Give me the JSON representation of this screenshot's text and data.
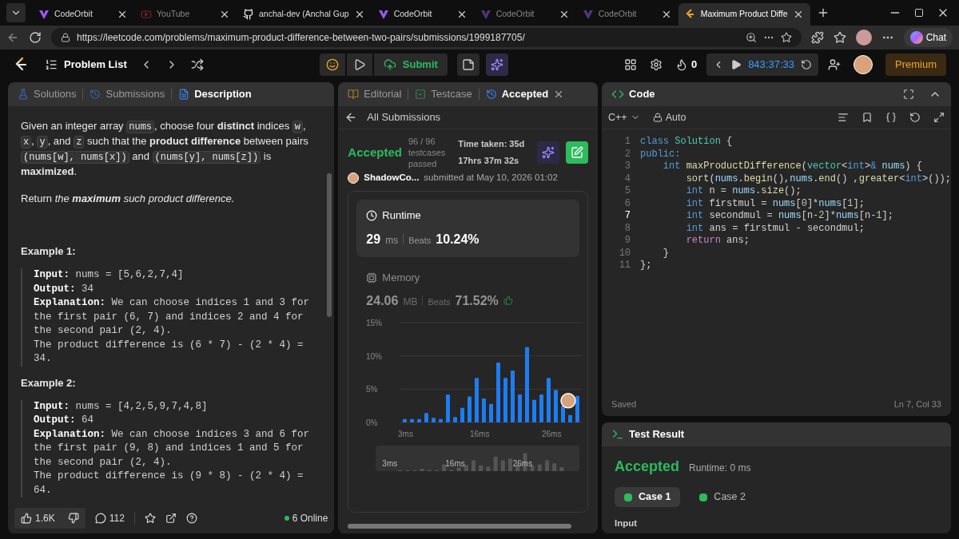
{
  "browser": {
    "tabs": [
      {
        "title": "CodeOrbit",
        "selected": false,
        "sleeping": false
      },
      {
        "title": "YouTube",
        "selected": false,
        "sleeping": true
      },
      {
        "title": "anchal-dev (Anchal Gup",
        "selected": false,
        "sleeping": false
      },
      {
        "title": "CodeOrbit",
        "selected": false,
        "sleeping": false
      },
      {
        "title": "CodeOrbit",
        "selected": false,
        "sleeping": true
      },
      {
        "title": "CodeOrbit",
        "selected": false,
        "sleeping": true
      },
      {
        "title": "Maximum Product Diffe",
        "selected": true,
        "sleeping": false
      }
    ],
    "url": "https://leetcode.com/problems/maximum-product-difference-between-two-pairs/submissions/1999187705/",
    "chat": "Chat"
  },
  "nav": {
    "problem_list": "Problem List",
    "submit": "Submit",
    "streak": "0",
    "timer": "843:37:33",
    "premium": "Premium"
  },
  "description_panel": {
    "tabs": [
      {
        "label": "Solutions",
        "selected": false
      },
      {
        "label": "Submissions",
        "selected": false
      },
      {
        "label": "Description",
        "selected": true
      }
    ],
    "paragraphs": [
      [
        {
          "kind": "text",
          "text": "Given an integer array "
        },
        {
          "kind": "code",
          "text": "nums"
        },
        {
          "kind": "text",
          "text": ", choose four **distinct** indices "
        },
        {
          "kind": "code",
          "text": "w"
        },
        {
          "kind": "text",
          "text": ", "
        },
        {
          "kind": "code",
          "text": "x"
        },
        {
          "kind": "text",
          "text": ", "
        },
        {
          "kind": "code",
          "text": "y"
        },
        {
          "kind": "text",
          "text": ", and "
        },
        {
          "kind": "code",
          "text": "z"
        },
        {
          "kind": "text",
          "text": " such that the **product difference** between pairs "
        },
        {
          "kind": "code",
          "text": "(nums[w], nums[x])"
        },
        {
          "kind": "text",
          "text": " and "
        },
        {
          "kind": "code",
          "text": "(nums[y], nums[z])"
        },
        {
          "kind": "text",
          "text": " is **maximized**."
        }
      ],
      [
        {
          "kind": "text",
          "text": "Return "
        },
        {
          "kind": "em",
          "text": "the **maximum** such product difference."
        }
      ]
    ],
    "examples": [
      {
        "title": "Example 1:",
        "lines": [
          {
            "label": "Input:",
            "text": "nums = [5,6,2,7,4]"
          },
          {
            "label": "Output:",
            "text": "34"
          },
          {
            "label": "Explanation:",
            "text": "We can choose indices 1 and 3 for the first pair (6, 7) and indices 2 and 4 for the second pair (2, 4)."
          },
          {
            "text": "The product difference is (6 * 7) - (2 * 4) = 34."
          }
        ]
      },
      {
        "title": "Example 2:",
        "lines": [
          {
            "label": "Input:",
            "text": "nums = [4,2,5,9,7,4,8]"
          },
          {
            "label": "Output:",
            "text": "64"
          },
          {
            "label": "Explanation:",
            "text": "We can choose indices 3 and 6 for the first pair (9, 8) and indices 1 and 5 for the second pair (2, 4)."
          },
          {
            "text": "The product difference is (9 * 8) - (2 * 4) = 64."
          }
        ]
      }
    ],
    "likes": "1.6K",
    "comments": "112",
    "online": "6 Online"
  },
  "submission_panel": {
    "tabs": [
      {
        "label": "Editorial",
        "selected": false,
        "closable": false
      },
      {
        "label": "Testcase",
        "selected": false,
        "closable": false
      },
      {
        "label": "Accepted",
        "selected": true,
        "closable": true
      }
    ],
    "back": "All Submissions",
    "status": "Accepted",
    "tests": [
      "96 / 96",
      "testcases",
      "passed"
    ],
    "time_taken": [
      "Time taken: 35d",
      "17hrs 37m 32s"
    ],
    "user": "ShadowCo...",
    "submitted": "submitted at May 10, 2026 01:02",
    "runtime": {
      "title": "Runtime",
      "value": "29",
      "unit": "ms",
      "beats_label": "Beats",
      "beats": "10.24%"
    },
    "memory": {
      "title": "Memory",
      "value": "24.06",
      "unit": "MB",
      "beats_label": "Beats",
      "beats": "71.52%"
    },
    "chart_data": {
      "type": "bar",
      "categories": [
        "3ms",
        null,
        null,
        null,
        null,
        null,
        null,
        null,
        null,
        null,
        "16ms",
        null,
        null,
        null,
        null,
        null,
        null,
        null,
        null,
        null,
        "26ms",
        null,
        null,
        null,
        null
      ],
      "values": [
        0.5,
        0.5,
        0.5,
        1.4,
        0.7,
        0.5,
        4.2,
        0.8,
        2.2,
        3.9,
        6.7,
        3.6,
        2.8,
        9.0,
        6.7,
        7.8,
        4.2,
        11.3,
        3.4,
        4.2,
        6.7,
        4.9,
        2.5,
        1.1,
        4.0
      ],
      "ylim": [
        0,
        15
      ],
      "yticks": [
        {
          "value": 0,
          "label": "0%"
        },
        {
          "value": 5,
          "label": "5%"
        },
        {
          "value": 10,
          "label": "10%"
        },
        {
          "value": 15,
          "label": "15%"
        }
      ]
    },
    "overview_labels": [
      "3ms",
      "16ms",
      "26ms"
    ]
  },
  "code_panel": {
    "title": "Code",
    "language": "C++",
    "mode": "Auto",
    "lines": [
      {
        "number": "1",
        "current": false,
        "tokens": [
          {
            "kind": "kw",
            "text": "class "
          },
          {
            "kind": "type",
            "text": "Solution"
          },
          {
            "kind": "p",
            "text": " {"
          }
        ]
      },
      {
        "number": "2",
        "current": false,
        "tokens": [
          {
            "kind": "kw",
            "text": "public:"
          }
        ]
      },
      {
        "number": "3",
        "current": false,
        "tokens": [
          {
            "kind": "kw",
            "text": "    int "
          },
          {
            "kind": "fn",
            "text": "maxProductDifference"
          },
          {
            "kind": "p",
            "text": "("
          },
          {
            "kind": "type",
            "text": "vector"
          },
          {
            "kind": "p",
            "text": "<"
          },
          {
            "kind": "kw",
            "text": "int"
          },
          {
            "kind": "p",
            "text": ">"
          },
          {
            "kind": "kw",
            "text": "& "
          },
          {
            "kind": "var",
            "text": "nums"
          },
          {
            "kind": "p",
            "text": ") {"
          }
        ]
      },
      {
        "number": "4",
        "current": false,
        "tokens": [
          {
            "kind": "fn",
            "text": "        sort"
          },
          {
            "kind": "p",
            "text": "("
          },
          {
            "kind": "var",
            "text": "nums"
          },
          {
            "kind": "p",
            "text": "."
          },
          {
            "kind": "fn",
            "text": "begin"
          },
          {
            "kind": "p",
            "text": "(),"
          },
          {
            "kind": "var",
            "text": "nums"
          },
          {
            "kind": "p",
            "text": "."
          },
          {
            "kind": "fn",
            "text": "end"
          },
          {
            "kind": "p",
            "text": "() ,"
          },
          {
            "kind": "fn",
            "text": "greater"
          },
          {
            "kind": "p",
            "text": "<"
          },
          {
            "kind": "kw",
            "text": "int"
          },
          {
            "kind": "p",
            "text": ">());"
          }
        ]
      },
      {
        "number": "5",
        "current": false,
        "tokens": [
          {
            "kind": "kw",
            "text": "        int "
          },
          {
            "kind": "p",
            "text": "n = "
          },
          {
            "kind": "var",
            "text": "nums"
          },
          {
            "kind": "p",
            "text": "."
          },
          {
            "kind": "fn",
            "text": "size"
          },
          {
            "kind": "p",
            "text": "();"
          }
        ]
      },
      {
        "number": "6",
        "current": false,
        "tokens": [
          {
            "kind": "kw",
            "text": "        int "
          },
          {
            "kind": "p",
            "text": "firstmul = "
          },
          {
            "kind": "var",
            "text": "nums"
          },
          {
            "kind": "p",
            "text": "["
          },
          {
            "kind": "num",
            "text": "0"
          },
          {
            "kind": "p",
            "text": "]*"
          },
          {
            "kind": "var",
            "text": "nums"
          },
          {
            "kind": "p",
            "text": "["
          },
          {
            "kind": "num",
            "text": "1"
          },
          {
            "kind": "p",
            "text": "];"
          }
        ]
      },
      {
        "number": "7",
        "current": true,
        "tokens": [
          {
            "kind": "kw",
            "text": "        int "
          },
          {
            "kind": "p",
            "text": "secondmul = "
          },
          {
            "kind": "var",
            "text": "nums"
          },
          {
            "kind": "p",
            "text": "[n-"
          },
          {
            "kind": "num",
            "text": "2"
          },
          {
            "kind": "p",
            "text": "]*"
          },
          {
            "kind": "var",
            "text": "nums"
          },
          {
            "kind": "p",
            "text": "[n-"
          },
          {
            "kind": "num",
            "text": "1"
          },
          {
            "kind": "p",
            "text": "];"
          }
        ]
      },
      {
        "number": "8",
        "current": false,
        "tokens": [
          {
            "kind": "kw",
            "text": "        int "
          },
          {
            "kind": "p",
            "text": "ans = firstmul - secondmul;"
          }
        ]
      },
      {
        "number": "9",
        "current": false,
        "tokens": [
          {
            "kind": "ctrl",
            "text": "        return "
          },
          {
            "kind": "p",
            "text": "ans;"
          }
        ]
      },
      {
        "number": "10",
        "current": false,
        "tokens": [
          {
            "kind": "p",
            "text": "    }"
          }
        ]
      },
      {
        "number": "11",
        "current": false,
        "tokens": [
          {
            "kind": "p",
            "text": "};"
          }
        ]
      }
    ],
    "saved": "Saved",
    "cursor": "Ln 7, Col 33"
  },
  "test_result": {
    "title": "Test Result",
    "status": "Accepted",
    "runtime": "Runtime: 0 ms",
    "cases": [
      {
        "label": "Case 1",
        "selected": true,
        "passed": true
      },
      {
        "label": "Case 2",
        "selected": false,
        "passed": true
      }
    ],
    "input_label": "Input"
  }
}
